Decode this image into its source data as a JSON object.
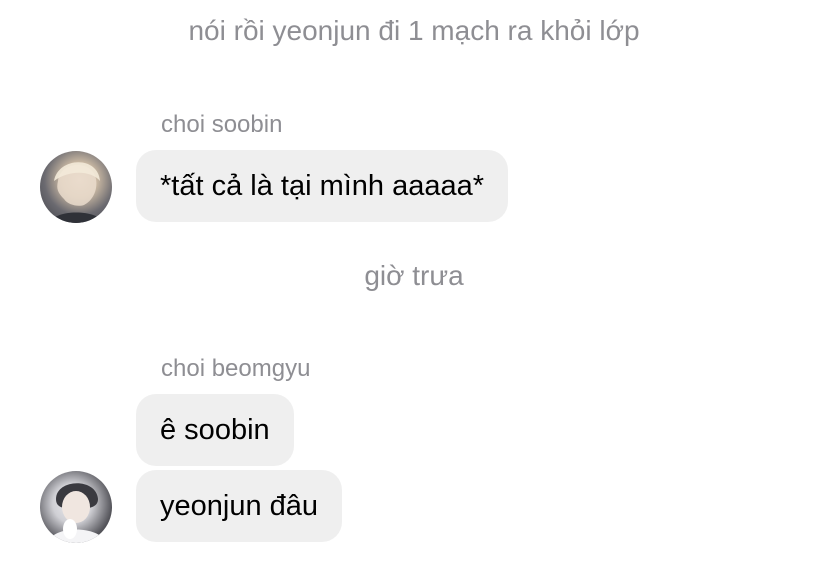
{
  "system_notes": [
    {
      "text": "nói rồi yeonjun đi 1 mạch ra khỏi lớp"
    },
    {
      "text": "giờ trưa"
    }
  ],
  "messages": [
    {
      "sender": "choi soobin",
      "bubbles": [
        "*tất cả là tại mình aaaaa*"
      ]
    },
    {
      "sender": "choi beomgyu",
      "bubbles": [
        "ê soobin",
        "yeonjun đâu"
      ]
    }
  ],
  "colors": {
    "bubble_bg": "#efefef",
    "meta_text": "#8e8e93",
    "message_text": "#000000"
  }
}
